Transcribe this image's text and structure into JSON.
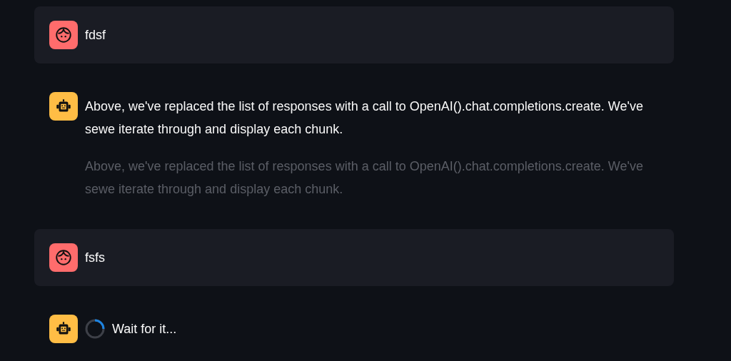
{
  "messages": [
    {
      "kind": "user",
      "blocks": [
        {
          "kind": "text",
          "text": "fdsf",
          "stale": false
        }
      ]
    },
    {
      "kind": "assistant",
      "blocks": [
        {
          "kind": "text",
          "text": "Above, we've replaced the list of responses with a call to OpenAI().chat.completions.create. We've sewe iterate through and display each chunk.",
          "stale": false
        },
        {
          "kind": "text",
          "text": "Above, we've replaced the list of responses with a call to OpenAI().chat.completions.create. We've sewe iterate through and display each chunk.",
          "stale": true
        }
      ]
    },
    {
      "kind": "user",
      "blocks": [
        {
          "kind": "text",
          "text": "fsfs",
          "stale": false
        }
      ]
    },
    {
      "kind": "assistant",
      "blocks": [
        {
          "kind": "spinner",
          "text": "Wait for it..."
        }
      ]
    }
  ]
}
